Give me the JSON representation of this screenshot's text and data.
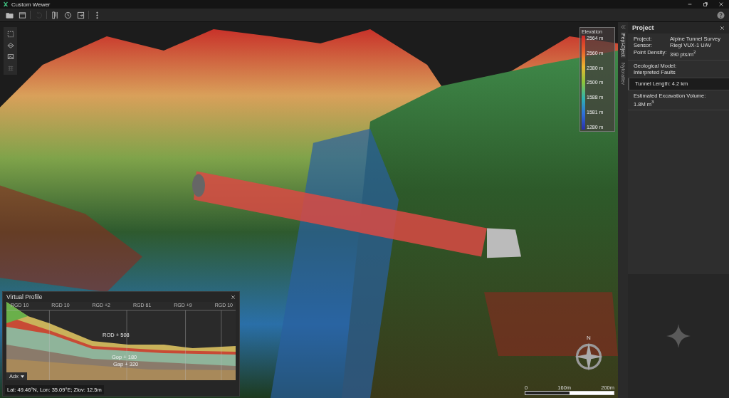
{
  "window": {
    "title": "Custom Wewer"
  },
  "toolbar": {
    "tools": [
      {
        "kind": "folder",
        "disabled": false
      },
      {
        "kind": "window",
        "disabled": false
      },
      {
        "kind": "undo",
        "disabled": true
      },
      {
        "kind": "ruler",
        "disabled": false
      },
      {
        "kind": "clock",
        "disabled": false
      },
      {
        "kind": "export",
        "disabled": false
      },
      {
        "kind": "more",
        "disabled": false
      }
    ]
  },
  "view_tools": [
    {
      "kind": "select",
      "disabled": false
    },
    {
      "kind": "layers",
      "disabled": false
    },
    {
      "kind": "image",
      "disabled": false
    },
    {
      "kind": "grid",
      "disabled": true
    }
  ],
  "legend": {
    "title": "Elevation",
    "ticks": [
      "2564 m",
      "2560 m",
      "2380 m",
      "2500 m",
      "1588 m",
      "1581 m",
      "1280 m"
    ]
  },
  "side_tabs": [
    {
      "label": "Pepl-Oject",
      "selected": true
    },
    {
      "label": "Nyloratlev",
      "selected": false
    }
  ],
  "project_panel": {
    "title": "Project",
    "sections": [
      {
        "kind": "pairs",
        "highlighted": false,
        "rows": [
          {
            "key": "Project:",
            "value": "Alpine Tunnel Survey"
          },
          {
            "key": "Sensor:",
            "value": "Riegl VUX-1 UAV"
          },
          {
            "key": "Point Density:",
            "value": "390 pts/m$^{2}$"
          }
        ]
      },
      {
        "kind": "lines",
        "highlighted": false,
        "lines": [
          "Geological Model:",
          "Interpreted Faults"
        ]
      },
      {
        "kind": "lines",
        "highlighted": true,
        "lines": [
          "Tunnel Length: 4.2 km"
        ]
      },
      {
        "kind": "lines",
        "highlighted": false,
        "lines": [
          "Estimated Excavation Volume:",
          "1.8M m$^{3}$"
        ]
      }
    ]
  },
  "profile": {
    "title": "Virtual Profile",
    "axis_labels": [
      "RGD 10",
      "RGD 10",
      "RGD +2",
      "RGD 61",
      "RGD +9",
      "RGD 10"
    ],
    "annotations": [
      "ROD + 508",
      "Gop + 180",
      "Gap + 320"
    ],
    "dropdown": "Adx",
    "coordinates": "Lat: 49.46°N, Lon: 35.09°E; Zlov: 12.5m"
  },
  "compass": {
    "label": "N"
  },
  "scale": {
    "labels": [
      "0",
      "160m",
      "200m"
    ]
  }
}
